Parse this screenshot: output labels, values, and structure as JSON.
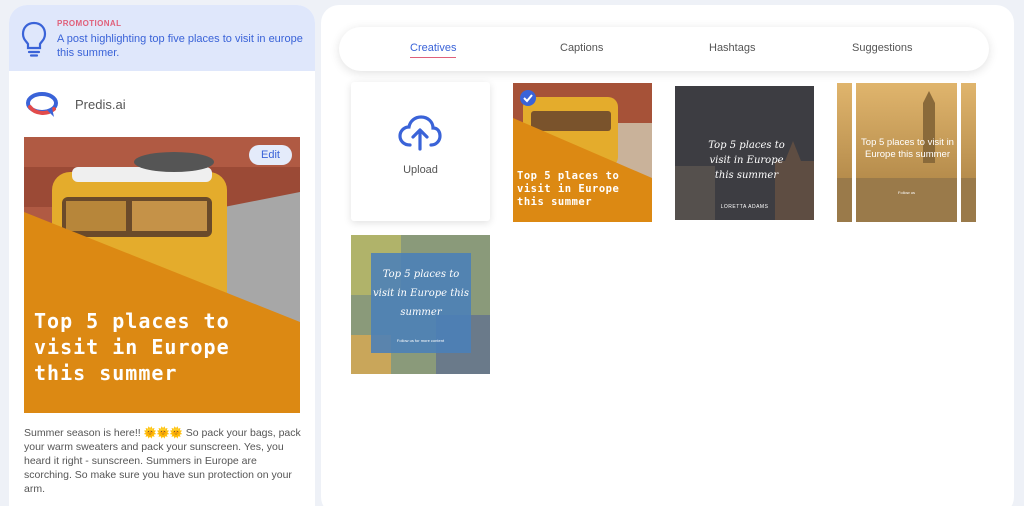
{
  "prompt": {
    "label": "PROMOTIONAL",
    "text": "A post highlighting top five places to visit in europe this summer."
  },
  "brand": {
    "name": "Predis.ai"
  },
  "preview": {
    "edit_label": "Edit",
    "title": "Top 5 places to visit in Europe this summer"
  },
  "caption": {
    "before": "Summer season is here!! ",
    "emoji": "🌞🌞🌞",
    "after": " So pack your bags, pack your warm sweaters and pack your sunscreen. Yes, you heard it right - sunscreen. Summers in Europe are scorching. So make sure you have sun protection on your arm."
  },
  "tabs": [
    "Creatives",
    "Captions",
    "Hashtags",
    "Suggestions"
  ],
  "upload": {
    "label": "Upload"
  },
  "creatives": [
    {
      "title": "Top 5 places to visit in Europe this summer"
    },
    {
      "title": "Top 5 places to visit in Europe this summer",
      "subtitle": "LORETTA ADAMS"
    },
    {
      "title": "Top 5 places to visit in Europe this summer",
      "subtitle": "Follow us"
    },
    {
      "title": "Top 5 places to visit in Europe this summer",
      "subtitle": "Follow us for more content"
    }
  ]
}
